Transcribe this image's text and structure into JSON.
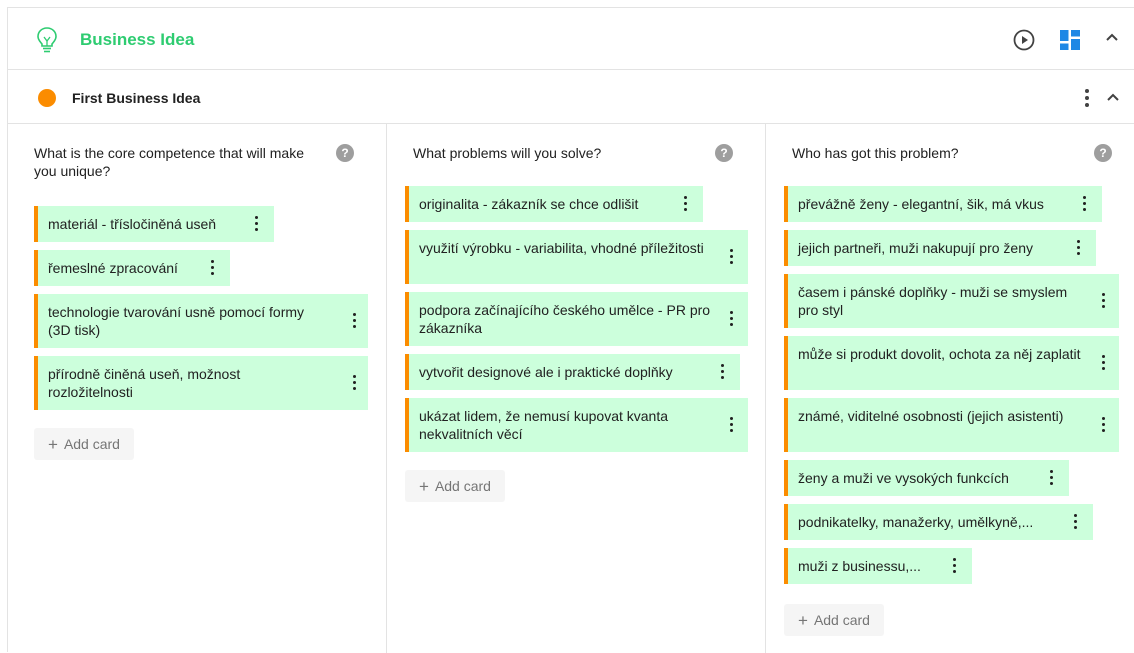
{
  "section": {
    "title": "Business Idea"
  },
  "idea": {
    "title": "First Business Idea",
    "dot_color": "#fb8c00"
  },
  "colors": {
    "accent_green": "#2ecc71",
    "card_bg": "#ccffdc",
    "card_border": "#fb8c00",
    "dashboard_blue": "#1e88e5"
  },
  "columns": [
    {
      "title": "What is the core competence that will make you unique?",
      "cards": [
        "materiál - třísločiněná useň",
        "řemeslné zpracování",
        "technologie tvarování usně pomocí formy (3D tisk)",
        "přírodně činěná useň, možnost rozložitelnosti"
      ],
      "add_label": "Add card"
    },
    {
      "title": "What problems will you solve?",
      "cards": [
        "originalita - zákazník se chce odlišit",
        "využití výrobku - variabilita, vhodné příležitosti",
        "podpora začínajícího českého umělce - PR pro zákazníka",
        "vytvořit designové ale i praktické doplňky",
        "ukázat lidem, že nemusí kupovat kvanta nekvalitních věcí"
      ],
      "add_label": "Add card"
    },
    {
      "title": "Who has got this problem?",
      "cards": [
        "převážně ženy - elegantní, šik, má vkus",
        "jejich partneři, muži nakupují pro ženy",
        "časem i pánské doplňky - muži se smyslem pro styl",
        "může si produkt dovolit, ochota za něj zaplatit",
        "známé, viditelné osobnosti (jejich asistenti)",
        "ženy a muži ve vysokých funkcích",
        "podnikatelky, manažerky, umělkyně,...",
        "muži z businessu,..."
      ],
      "add_label": "Add card"
    }
  ],
  "help_glyph": "?",
  "add_plus": "+"
}
